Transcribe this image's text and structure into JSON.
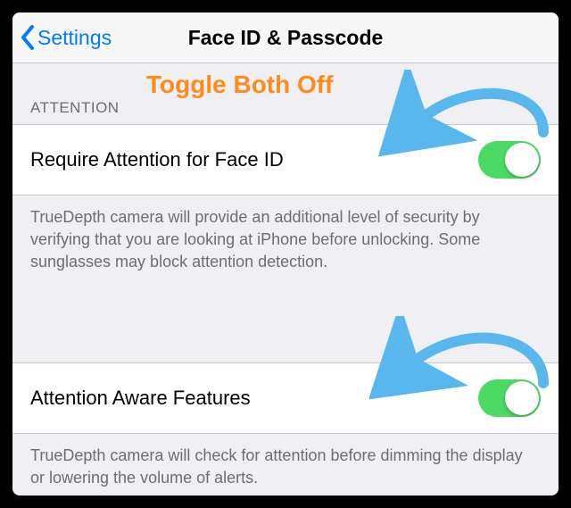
{
  "nav": {
    "back_label": "Settings",
    "title": "Face ID & Passcode"
  },
  "annotation": {
    "text": "Toggle Both Off"
  },
  "section": {
    "header": "ATTENTION"
  },
  "cells": {
    "require": {
      "label": "Require Attention for Face ID",
      "on": true,
      "footer": "TrueDepth camera will provide an additional level of security by verifying that you are looking at iPhone before unlocking. Some sunglasses may block attention detection."
    },
    "aware": {
      "label": "Attention Aware Features",
      "on": true,
      "footer": "TrueDepth camera will check for attention before dimming the display or lowering the volume of alerts."
    }
  },
  "colors": {
    "accent_blue": "#007aff",
    "toggle_green": "#4cd964",
    "annotation_orange": "#ff8c1a",
    "arrow_blue": "#58b7ec"
  }
}
